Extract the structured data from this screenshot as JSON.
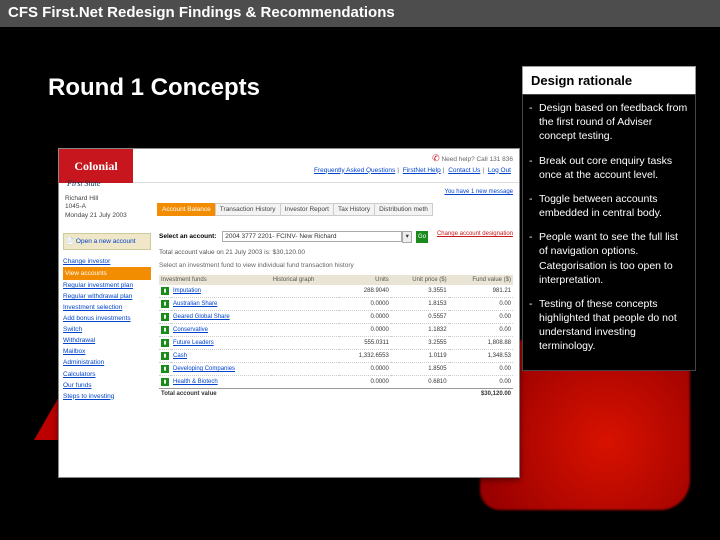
{
  "header": "CFS First.Net Redesign Findings & Recommendations",
  "subtitle": "Round 1 Concepts",
  "panel": {
    "title": "Design rationale",
    "items": [
      "Design based on feedback from the first round of Adviser concept testing.",
      "Break out core enquiry tasks once at the account level.",
      "Toggle between accounts embedded in central body.",
      "People want to see the full list of navigation options. Categorisation is too open to interpretation.",
      "Testing of these concepts highlighted that people do not understand investing terminology."
    ]
  },
  "screenshot": {
    "logo": "Colonial",
    "logo_sub": "First State",
    "help": "Need help? Call 131 836",
    "toplinks": [
      "Frequently Asked Questions",
      "FirstNet Help",
      "Contact Us",
      "Log Out"
    ],
    "view_msg": "You have 1 new message",
    "user": {
      "name": "Richard Hill",
      "id": "1045-A",
      "date": "Monday 21 July 2003"
    },
    "tabs": [
      "Account Balance",
      "Transaction History",
      "Investor Report",
      "Tax History",
      "Distribution meth"
    ],
    "sidebar": {
      "open_new": "Open a new account",
      "links": [
        "Change investor",
        "View accounts",
        "Regular investment plan",
        "Regular withdrawal plan",
        "Investment selection",
        "Add bonus investments",
        "Switch",
        "Withdrawal",
        "Mailbox",
        "Administration",
        "Calculators",
        "Our funds",
        "Steps to investing"
      ],
      "current_index": 1
    },
    "main": {
      "select_label": "Select an account:",
      "select_value": "2004 3777 2201- FCINV- New Richard",
      "change": "Change account designation",
      "total_line": "Total account value on 21 July 2003 is: $30,120.00",
      "sub_line": "Select an investment fund to view individual fund transaction history",
      "columns": [
        "Investment funds",
        "Historical graph",
        "Units",
        "Unit price ($)",
        "Fund value ($)"
      ],
      "rows": [
        {
          "fund": "Imputation",
          "units": "288.9040",
          "price": "3.3551",
          "value": "981.21"
        },
        {
          "fund": "Australian Share",
          "units": "0.0000",
          "price": "1.8153",
          "value": "0.00"
        },
        {
          "fund": "Geared Global Share",
          "units": "0.0000",
          "price": "0.5557",
          "value": "0.00"
        },
        {
          "fund": "Conservative",
          "units": "0.0000",
          "price": "1.1832",
          "value": "0.00"
        },
        {
          "fund": "Future Leaders",
          "units": "555.0311",
          "price": "3.2555",
          "value": "1,808.88"
        },
        {
          "fund": "Cash",
          "units": "1,332.6553",
          "price": "1.0119",
          "value": "1,348.53"
        },
        {
          "fund": "Developing Companies",
          "units": "0.0000",
          "price": "1.8505",
          "value": "0.00"
        },
        {
          "fund": "Health & Biotech",
          "units": "0.0000",
          "price": "0.6810",
          "value": "0.00"
        }
      ],
      "total_label": "Total account value",
      "total_value": "$30,120.00"
    }
  }
}
